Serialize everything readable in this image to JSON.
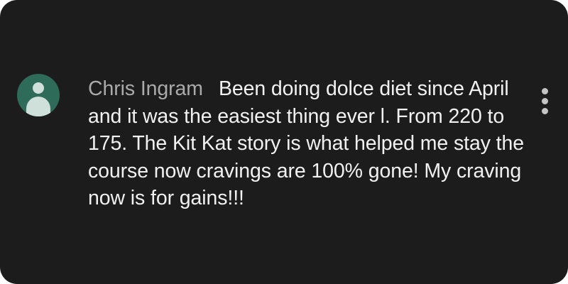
{
  "comment": {
    "author": "Chris Ingram",
    "text": "Been doing dolce diet since April and it was the easiest thing ever l. From 220 to 175. The Kit Kat story is what helped me stay the course now cravings are 100% gone! My craving now is for gains!!!"
  },
  "icons": {
    "avatar": "default-user-avatar-icon",
    "menu": "more-vert-icon"
  },
  "colors": {
    "background": "#1c1c1c",
    "avatar_bg": "#2e6b59",
    "author_text": "#aaaaaa",
    "body_text": "#f1f1f1"
  }
}
